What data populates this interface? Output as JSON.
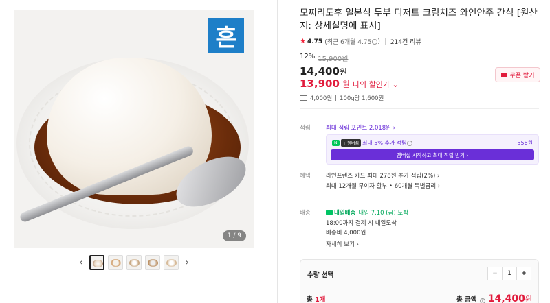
{
  "gallery": {
    "brand_mark": "흔",
    "counter": "1 / 9",
    "prev_arrow": "‹",
    "next_arrow": "›"
  },
  "product": {
    "title": "모찌리도후 일본식 두부 디저트 크림치즈 와인안주 간식 [원산지: 상세설명에 표시]",
    "rating": "4.75",
    "rating_recent": "(최근 6개월 4.75",
    "review_count": "214건 리뷰",
    "discount_rate": "12%",
    "original_price": "15,900원",
    "price": "14,400",
    "price_unit": "원",
    "my_price": "13,900",
    "my_price_unit": "원",
    "my_price_label": "나의 할인가 ⌄",
    "coupon_label": "쿠폰 받기",
    "shipping_fee": "4,000원",
    "unit_price": "100g당 1,600원"
  },
  "points": {
    "label": "적립",
    "max_points": "최대 적립 포인트 2,018원 ›",
    "npay_badge_n": "N",
    "npay_badge_plus": "+ 멤버십",
    "npay_text": "최대 5% 추가 적립",
    "npay_amount": "556원",
    "membership_button": "멤버십 시작하고 최대 적립 받기 ›"
  },
  "benefits": {
    "label": "혜택",
    "line1": "라인프렌즈 카드 최대 278원 추가 적립(2%) ›",
    "line2": "최대 12개월 무이자 할부 • 60개월 특별금리 ›"
  },
  "delivery": {
    "label": "배송",
    "badge": "내일배송",
    "date": "내일 7.10 (금) 도착",
    "cutoff": "18:00까지 결제 시 내일도착",
    "fee": "배송비 4,000원",
    "detail_link": "자세히 보기 ›"
  },
  "order": {
    "qty_label": "수량 선택",
    "minus": "−",
    "quantity": "1",
    "plus": "+",
    "total_label": "총",
    "total_count": "1개",
    "total_amount_label": "총 금액",
    "total_amount": "14,400",
    "total_amount_unit": "원"
  },
  "colors": {
    "accent_red": "#e11b3c",
    "naver_purple": "#6a2fd8",
    "naver_green": "#03c75a"
  }
}
